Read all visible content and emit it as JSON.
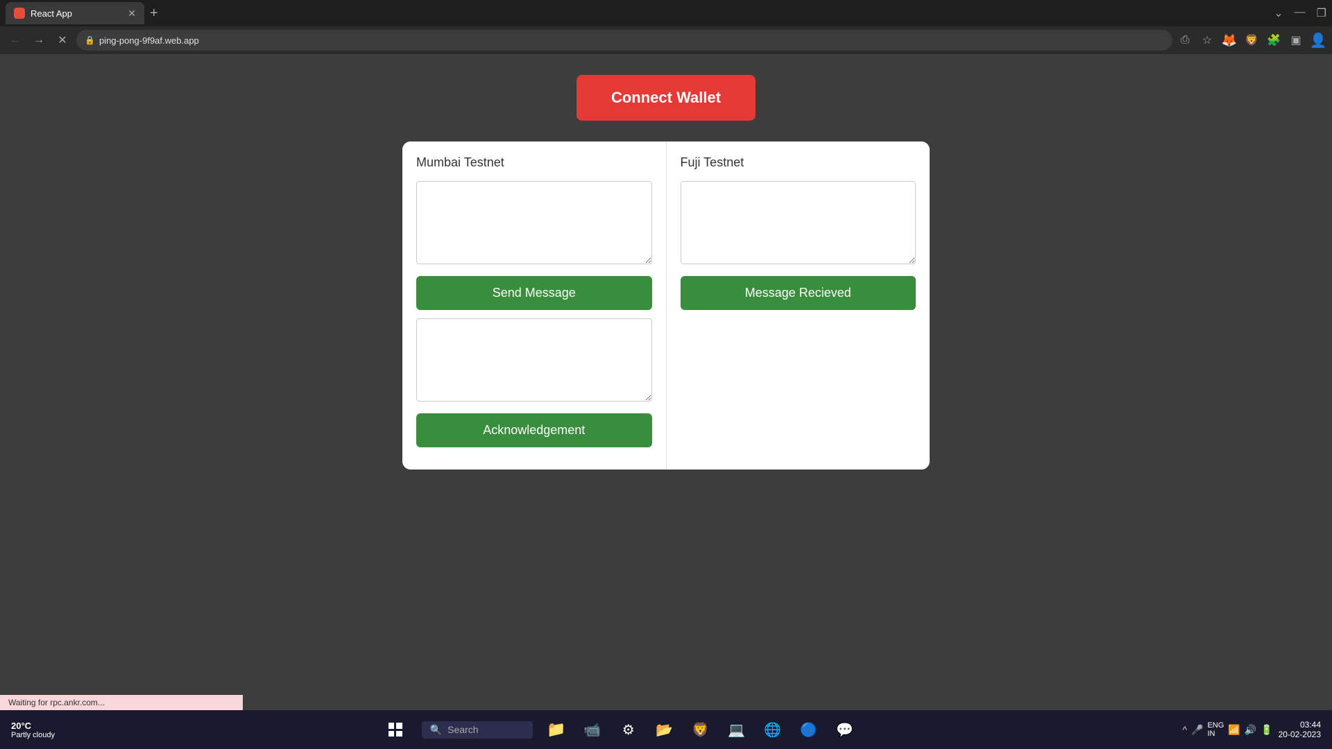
{
  "browser": {
    "tab_title": "React App",
    "tab_new_symbol": "+",
    "address": "ping-pong-9f9af.web.app",
    "loading": true
  },
  "app": {
    "connect_wallet_label": "Connect Wallet",
    "left_card": {
      "title": "Mumbai Testnet",
      "send_button": "Send Message",
      "acknowledgement_button": "Acknowledgement"
    },
    "right_card": {
      "title": "Fuji Testnet",
      "message_received_button": "Message Recieved"
    }
  },
  "status_bar": {
    "text": "Waiting for rpc.ankr.com..."
  },
  "taskbar": {
    "weather_temp": "20°C",
    "weather_desc": "Partly cloudy",
    "search_label": "Search",
    "lang": "ENG\nIN",
    "time": "03:44",
    "date": "20-02-2023"
  }
}
